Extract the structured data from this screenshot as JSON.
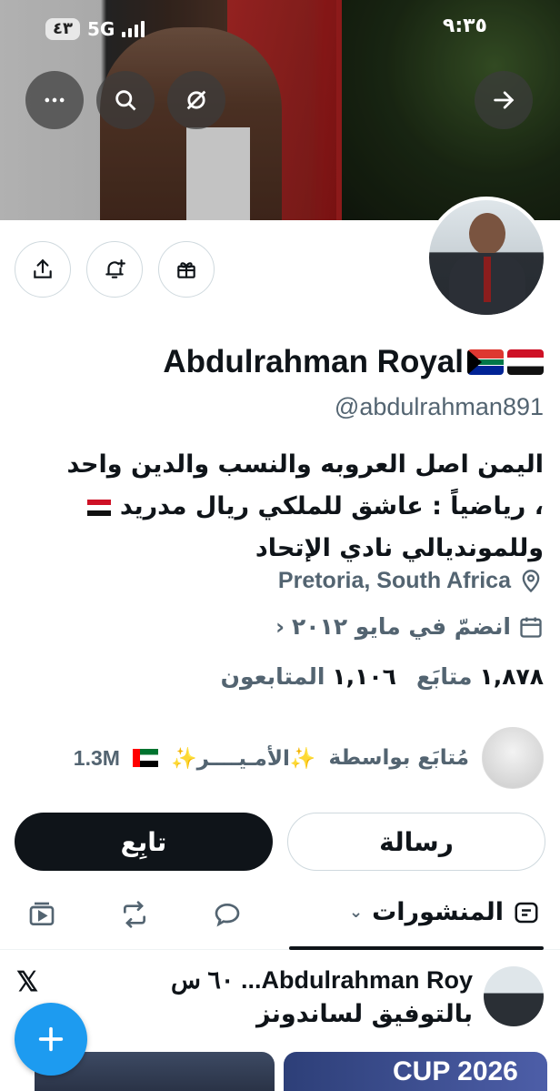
{
  "status_bar": {
    "battery": "٤٣",
    "network": "5G",
    "time": "٩:٣٥"
  },
  "profile": {
    "display_name": "Abdulrahman Royal",
    "handle": "@abdulrahman891",
    "bio_line1": "اليمن اصل العروبه والنسب والدين واحد",
    "bio_line2": "، رياضياً : عاشق للملكي ريال مدريد",
    "bio_line3": "وللمونديالي نادي الإتحاد",
    "location": "Pretoria, South Africa",
    "joined": "انضمّ في مايو ٢٠١٢",
    "following_count": "١,٨٧٨",
    "following_label": "متابَع",
    "followers_count": "١,١٠٦",
    "followers_label": "المتابعون",
    "followed_by_label": "مُتابَع بواسطة",
    "followed_by_name": "✨الأمـيــــر✨",
    "followed_by_count": "1.3M"
  },
  "buttons": {
    "follow": "تابِع",
    "message": "رسالة"
  },
  "tabs": {
    "posts": "المنشورات"
  },
  "post": {
    "author": "Abdulrahman Roy...",
    "time": "٦٠ س",
    "text": "بالتوفيق لساندونز",
    "media_text": "CUP 2026"
  },
  "x_logo": "𝕏",
  "colors": {
    "accent": "#1d9bf0",
    "text": "#0f1419",
    "secondary": "#536471"
  }
}
